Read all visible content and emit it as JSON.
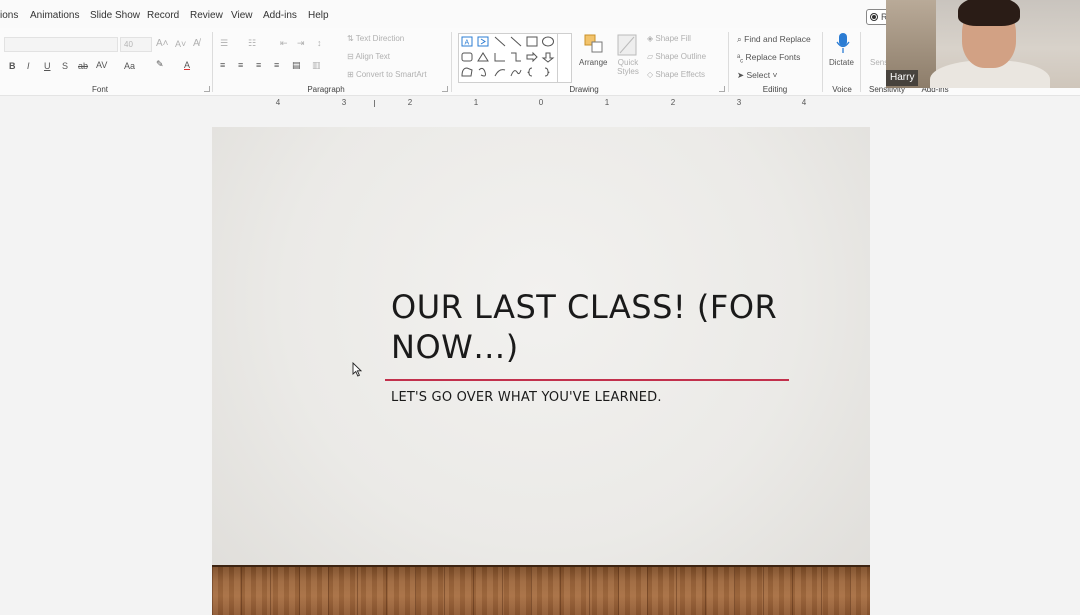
{
  "tabs": {
    "items": [
      "ions",
      "Animations",
      "Slide Show",
      "Record",
      "Review",
      "View",
      "Add-ins",
      "Help"
    ],
    "record_button": "R"
  },
  "ribbon": {
    "font": {
      "label": "Font",
      "size_placeholder": "40",
      "bold": "B",
      "italic": "I",
      "underline": "U",
      "strike": "S",
      "spacing": "AV",
      "case": "Aa",
      "color": "A"
    },
    "paragraph": {
      "label": "Paragraph",
      "text_direction": "Text Direction",
      "align_text": "Align Text",
      "convert_smartart": "Convert to SmartArt"
    },
    "drawing": {
      "label": "Drawing",
      "arrange": "Arrange",
      "quick_styles": "Quick Styles",
      "shape_fill": "Shape Fill",
      "shape_outline": "Shape Outline",
      "shape_effects": "Shape Effects"
    },
    "editing": {
      "label": "Editing",
      "find_replace": "Find and Replace",
      "replace_fonts": "Replace Fonts",
      "select": "Select"
    },
    "voice": {
      "label": "Voice",
      "dictate": "Dictate"
    },
    "sensitivity": {
      "label": "Sensitivity",
      "partial": "Sens"
    },
    "addins": {
      "label": "Add-ins"
    }
  },
  "ruler": {
    "numbers": [
      "4",
      "3",
      "2",
      "1",
      "0",
      "1",
      "2",
      "3",
      "4"
    ]
  },
  "slide": {
    "title": "OUR LAST CLASS! (FOR NOW…)",
    "subtitle": "LET'S GO OVER WHAT YOU'VE LEARNED.",
    "accent_color": "#c2304c"
  },
  "webcam": {
    "participant_name": "Harry"
  }
}
